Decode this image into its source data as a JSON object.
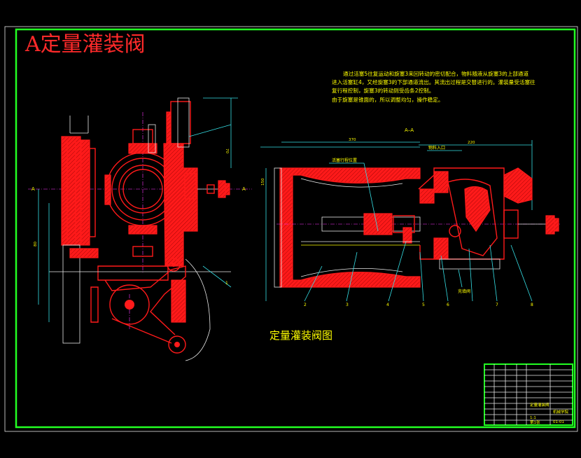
{
  "drawing": {
    "title": "A定量灌装阀",
    "caption": "定量灌装阀图",
    "section_label": "A–A",
    "section_mark_left": "A",
    "section_mark_right": "A",
    "notes": [
      "通过活塞5往复运动和旋塞3来回转动的密切配合，物料随液从旋塞3的上部通道",
      "进入活塞缸4，又经旋塞3的下部通道流出。其流出过程是交替进行的。灌装量受活塞往",
      "复行程控制，旋塞3的转动则受齿条2控制。",
      "由于旋塞是锥面的，所以调整均匀，操作稳定。"
    ],
    "labels": {
      "piston_stroke": "活塞行程位置",
      "material_inlet": "物料入口",
      "material_outlet": "充填阀"
    },
    "part_numbers_left": [
      "1"
    ],
    "part_numbers_right": [
      "2",
      "3",
      "4",
      "5",
      "6",
      "7",
      "8"
    ],
    "dims": [
      "370",
      "220",
      "150",
      "70",
      "80"
    ]
  },
  "title_block": {
    "drawing_name": "定量灌装阀",
    "school": "机械学院",
    "drawing_no": "01-01",
    "scale": "1:1",
    "sheet": "第1张"
  },
  "colors": {
    "frame": "#22ff22",
    "part": "#ff1a1a",
    "dimension": "#35e0e6",
    "text": "#ffff00",
    "centerline": "#ff35ff"
  }
}
